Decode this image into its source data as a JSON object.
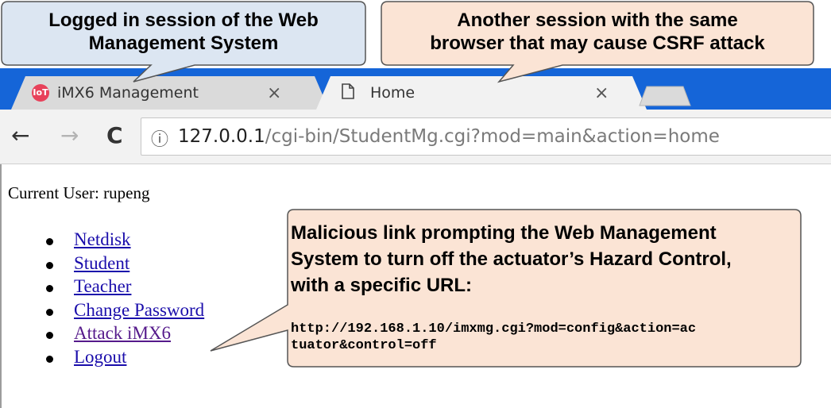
{
  "tabs": [
    {
      "title": "iMX6 Management",
      "icon": "iot-favicon-icon",
      "close": "×",
      "active": false
    },
    {
      "title": "Home",
      "icon": "page-icon",
      "close": "×",
      "active": true
    }
  ],
  "toolbar": {
    "back": "←",
    "forward": "→",
    "reload": "C",
    "info": "ⓘ",
    "url_host": "127.0.0.1",
    "url_path": "/cgi-bin/StudentMg.cgi?mod=main&action=home"
  },
  "page": {
    "current_user": "Current User: rupeng",
    "links": [
      "Netdisk",
      "Student",
      "Teacher",
      "Change Password",
      "Attack iMX6",
      "Logout"
    ]
  },
  "annotations": {
    "logged_in": {
      "line1": "Logged in session of the Web",
      "line2": "Management System"
    },
    "another_session": {
      "line1": "Another session with the same",
      "line2": "browser that may cause CSRF attack"
    },
    "malicious": {
      "line1": "Malicious link prompting the Web Management",
      "line2": "System to turn off the actuator’s Hazard Control,",
      "line3": "with a specific URL:",
      "url_line1": "http://192.168.1.10/imxmg.cgi?mod=config&action=ac",
      "url_line2": "tuator&control=off"
    }
  },
  "colors": {
    "tabstrip": "#1565d8",
    "inactive_tab": "#dadada",
    "active_tab": "#f2f2f2",
    "blue_callout": "#dce6f2",
    "peach_callout": "#fbe4d5",
    "link": "#1a0dab",
    "visited_link": "#551a8b"
  }
}
